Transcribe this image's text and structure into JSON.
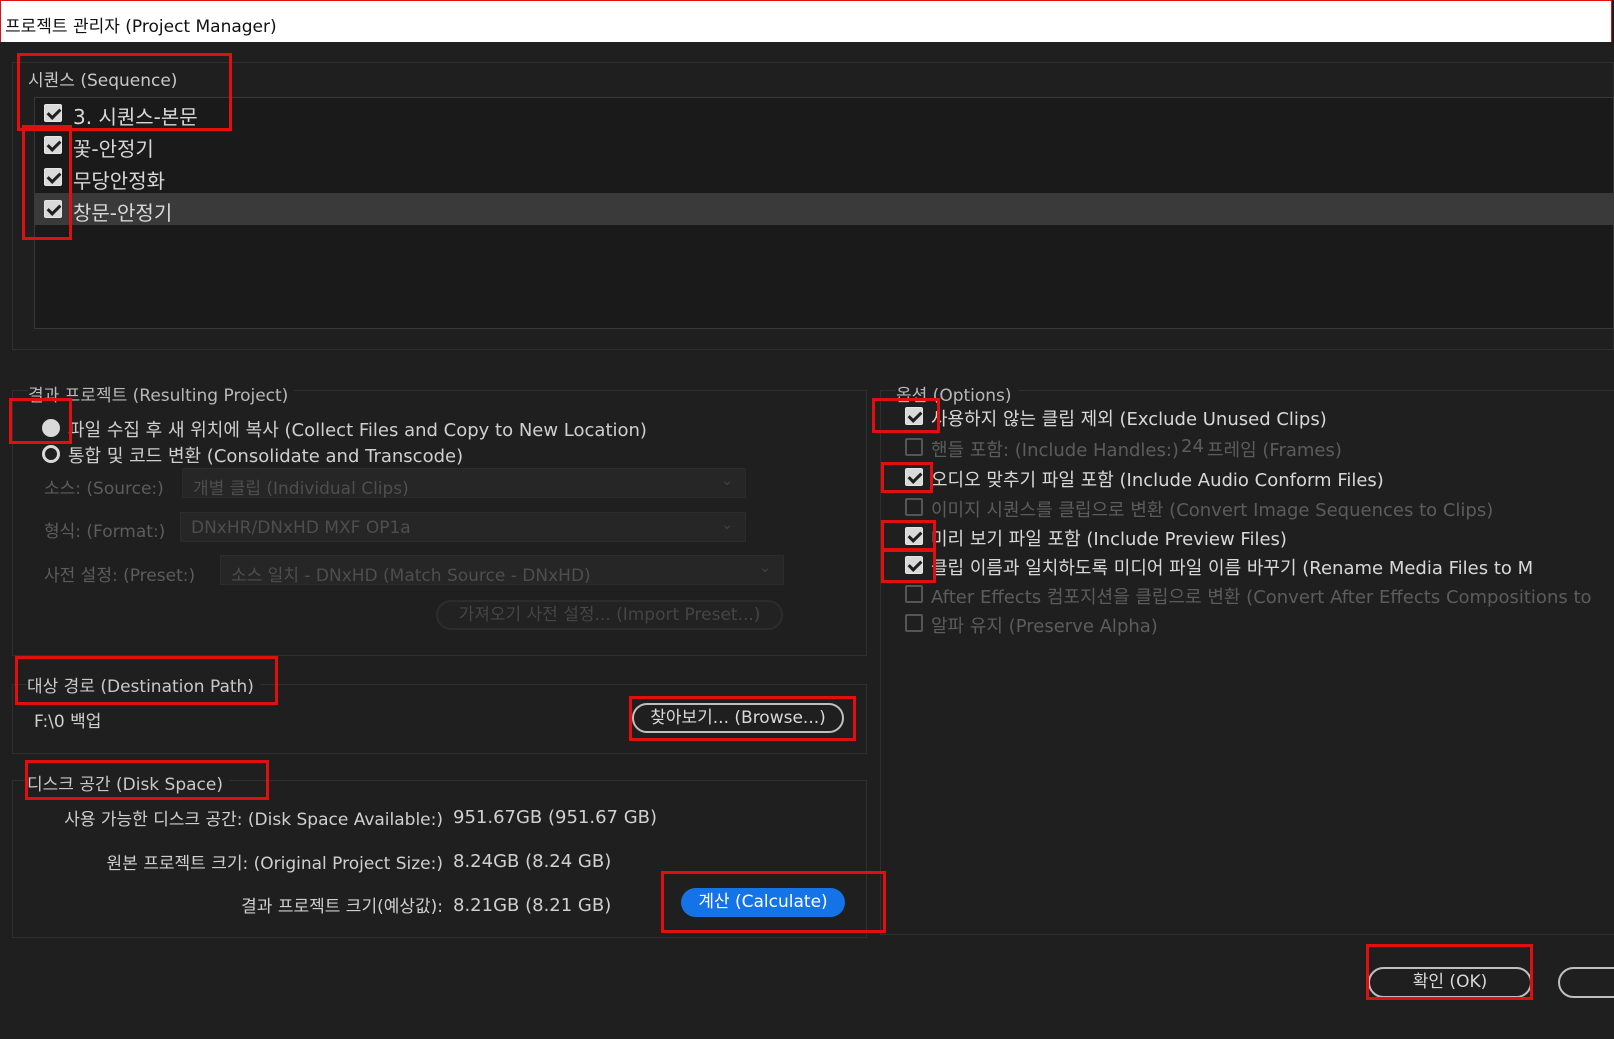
{
  "window": {
    "title": "프로젝트 관리자 (Project Manager)"
  },
  "sequence": {
    "legend": "시퀀스 (Sequence)",
    "items": [
      {
        "label": "3. 시퀀스-본문",
        "checked": true
      },
      {
        "label": "꽃-안정기",
        "checked": true
      },
      {
        "label": "무당안정화",
        "checked": true
      },
      {
        "label": "창문-안정기",
        "checked": true,
        "selected": true
      }
    ]
  },
  "resulting_project": {
    "legend": "결과 프로젝트 (Resulting Project)",
    "options": [
      {
        "label": "파일 수집 후 새 위치에 복사 (Collect Files and Copy to New Location)",
        "selected": true
      },
      {
        "label": "통합 및 코드 변환 (Consolidate and Transcode)",
        "selected": false
      }
    ],
    "source_label": "소스: (Source:)",
    "source_value": "개별 클립 (Individual Clips)",
    "format_label": "형식: (Format:)",
    "format_value": "DNxHR/DNxHD MXF OP1a",
    "preset_label": "사전 설정: (Preset:)",
    "preset_value": "소스 일치 - DNxHD (Match Source - DNxHD)",
    "import_preset": "가져오기 사전 설정... (Import Preset...)"
  },
  "destination": {
    "legend": "대상 경로 (Destination Path)",
    "path": "F:\\0 백업",
    "browse": "찾아보기... (Browse...)"
  },
  "disk_space": {
    "legend": "디스크 공간 (Disk Space)",
    "available_label": "사용 가능한 디스크 공간: (Disk Space Available:)",
    "available_value": "951.67GB (951.67 GB)",
    "original_label": "원본 프로젝트 크기: (Original Project Size:)",
    "original_value": "8.24GB (8.24 GB)",
    "result_label": "결과 프로젝트 크기(예상값):",
    "result_value": "8.21GB (8.21 GB)",
    "calculate": "계산 (Calculate)"
  },
  "options": {
    "legend": "옵션 (Options)",
    "exclude_unused": "사용하지 않는 클립 제외 (Exclude Unused Clips)",
    "include_handles": "핸들 포함: (Include Handles:)",
    "handles_value": "24",
    "handles_unit": "프레임 (Frames)",
    "include_audio": "오디오 맞추기 파일 포함 (Include Audio Conform Files)",
    "convert_image_seq": "이미지 시퀀스를 클립으로 변환 (Convert Image Sequences to Clips)",
    "include_preview": "미리 보기 파일 포함 (Include Preview Files)",
    "rename_media": "클립 이름과 일치하도록 미디어 파일 이름 바꾸기 (Rename Media Files to M",
    "convert_ae": "After Effects 컴포지션을 클립으로 변환 (Convert After Effects Compositions to",
    "preserve_alpha": "알파 유지 (Preserve Alpha)"
  },
  "footer": {
    "ok": "확인 (OK)"
  },
  "colors": {
    "accent": "#1473e6",
    "highlight": "#e01010",
    "background": "#1f1f1f"
  }
}
